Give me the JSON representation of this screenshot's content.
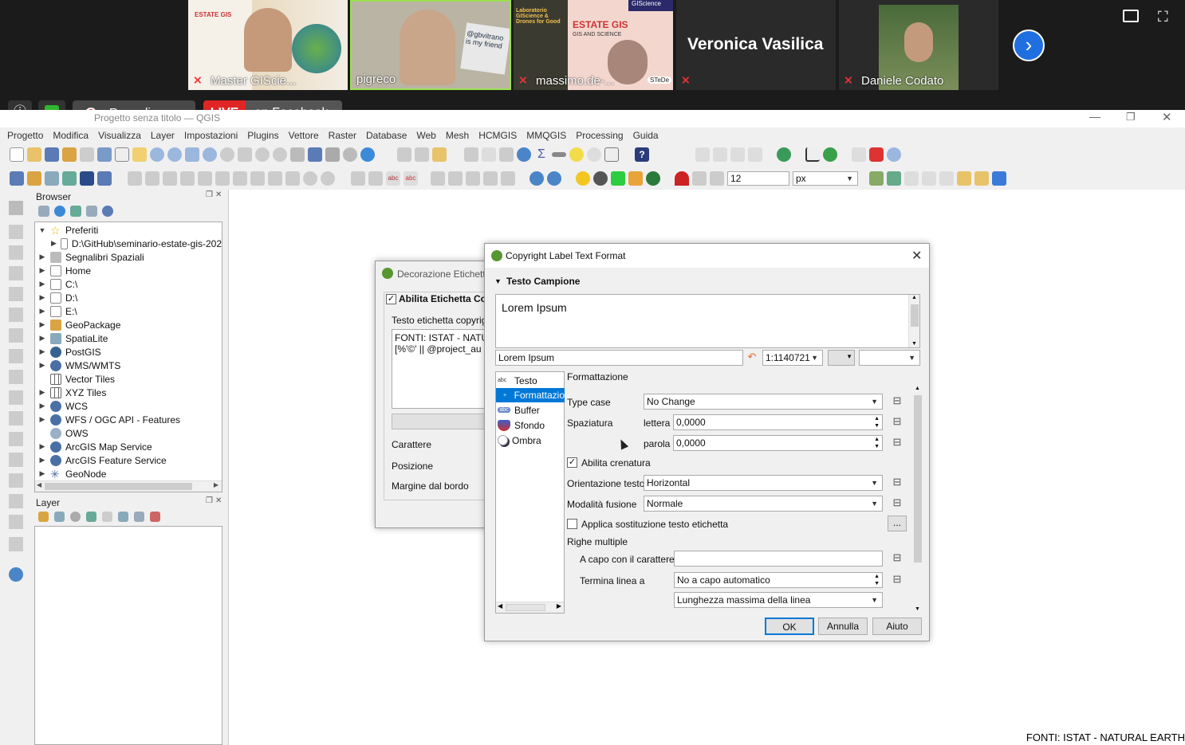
{
  "meeting": {
    "participants": [
      {
        "name": "Master GIScie...",
        "muted": true
      },
      {
        "name": "pigreco",
        "muted": false
      },
      {
        "name": "massimo.de-...",
        "muted": true
      },
      {
        "name": "Veronica Vasilica",
        "muted": true
      },
      {
        "name": "Daniele Codato",
        "muted": true
      }
    ],
    "recording_label": "Recording...",
    "live_label": "LIVE",
    "facebook_label": "on Facebook",
    "tile_texts": {
      "estate_gis": "ESTATE GIS",
      "laboratorio": "Laboratorio GIScience & Drones for Good",
      "gis_and_science": "GIS AND SCIENCE",
      "stede": "STeDe",
      "giscience": "GIScience",
      "sign": "@gbvitrano is my friend"
    }
  },
  "window": {
    "title": "Progetto senza titolo — QGIS"
  },
  "menu": [
    "Progetto",
    "Modifica",
    "Visualizza",
    "Layer",
    "Impostazioni",
    "Plugins",
    "Vettore",
    "Raster",
    "Database",
    "Web",
    "Mesh",
    "HCMGIS",
    "MMQGIS",
    "Processing",
    "Guida"
  ],
  "toolbar": {
    "font_size": "12",
    "unit": "px"
  },
  "browser": {
    "title": "Browser",
    "items": [
      {
        "label": "Preferiti",
        "expanded": true
      },
      {
        "label": "D:\\GitHub\\seminario-estate-gis-202",
        "child": true
      },
      {
        "label": "Segnalibri Spaziali"
      },
      {
        "label": "Home"
      },
      {
        "label": "C:\\"
      },
      {
        "label": "D:\\"
      },
      {
        "label": "E:\\"
      },
      {
        "label": "GeoPackage"
      },
      {
        "label": "SpatiaLite"
      },
      {
        "label": "PostGIS"
      },
      {
        "label": "WMS/WMTS"
      },
      {
        "label": "Vector Tiles"
      },
      {
        "label": "XYZ Tiles"
      },
      {
        "label": "WCS"
      },
      {
        "label": "WFS / OGC API - Features"
      },
      {
        "label": "OWS"
      },
      {
        "label": "ArcGIS Map Service"
      },
      {
        "label": "ArcGIS Feature Service"
      },
      {
        "label": "GeoNode"
      }
    ]
  },
  "layer_panel": {
    "title": "Layer"
  },
  "decoration_dialog": {
    "title": "Decorazione Etichetta",
    "enable_label": "Abilita Etichetta Co",
    "text_label": "Testo etichetta copyrig",
    "text_value": "FONTI: ISTAT - NATU\n[%'©' || @project_au",
    "font_label": "Carattere",
    "position_label": "Posizione",
    "margin_label": "Margine dal bordo"
  },
  "format_dialog": {
    "title": "Copyright Label Text Format",
    "sample_section": "Testo Campione",
    "sample_text": "Lorem Ipsum",
    "sample_input": "Lorem Ipsum",
    "scale": "1:1140721",
    "tabs": [
      "Testo",
      "Formattazio",
      "Buffer",
      "Sfondo",
      "Ombra"
    ],
    "active_tab": 1,
    "section_title": "Formattazione",
    "type_case_label": "Type case",
    "type_case_value": "No Change",
    "spacing_label": "Spaziatura",
    "letter_label": "lettera",
    "letter_value": "0,0000",
    "word_label": "parola",
    "word_value": "0,0000",
    "kerning_label": "Abilita crenatura",
    "kerning_checked": true,
    "orientation_label": "Orientazione testo",
    "orientation_value": "Horizontal",
    "blend_label": "Modalità fusione",
    "blend_value": "Normale",
    "substitution_label": "Applica sostituzione testo etichetta",
    "substitution_checked": false,
    "substitution_btn": "...",
    "multiline_label": "Righe multiple",
    "wrap_char_label": "A capo con il carattere",
    "wrap_char_value": "",
    "wrap_line_label": "Termina linea a",
    "wrap_line_value": "No a capo automatico",
    "wrap_mode_value": "Lunghezza massima della linea",
    "ok": "OK",
    "cancel": "Annulla",
    "help": "Aiuto"
  },
  "map_canvas": {
    "copyright_text": "FONTI: ISTAT - NATURAL EARTH"
  },
  "colors": {
    "accent": "#0078d7",
    "qgis_green": "#589632",
    "live_red": "#e02525",
    "zoom_bg": "#1b1b1b"
  }
}
